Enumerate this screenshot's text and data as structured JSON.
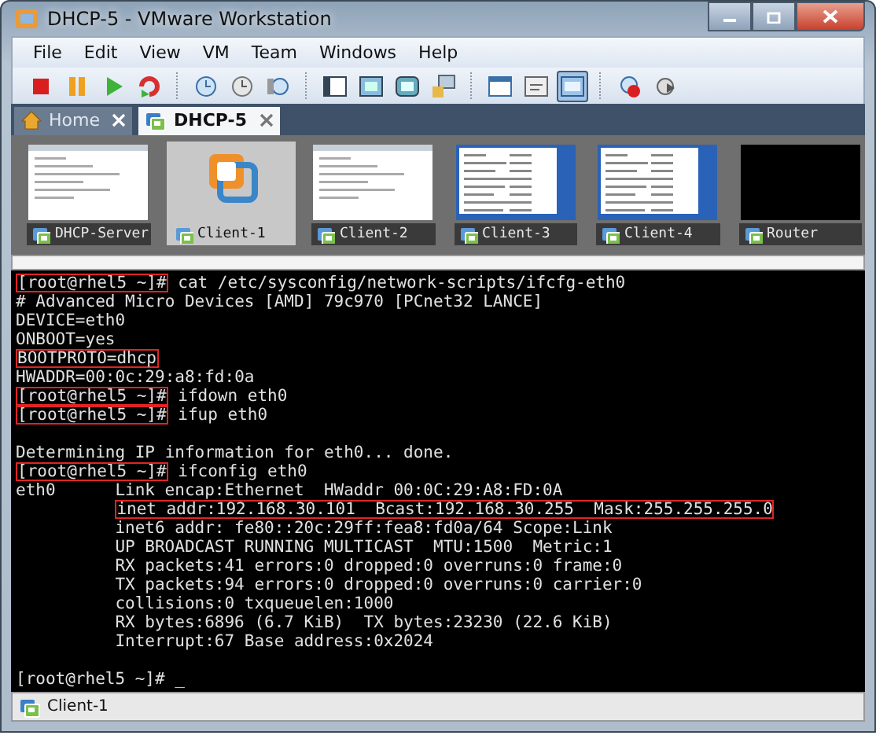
{
  "window": {
    "title": "DHCP-5 - VMware Workstation"
  },
  "menu": [
    "File",
    "Edit",
    "View",
    "VM",
    "Team",
    "Windows",
    "Help"
  ],
  "toolbar": [
    {
      "kind": "stop"
    },
    {
      "kind": "pause"
    },
    {
      "kind": "play"
    },
    {
      "kind": "reset"
    },
    {
      "kind": "sep"
    },
    {
      "kind": "snapshot"
    },
    {
      "kind": "snapshot-revert"
    },
    {
      "kind": "snapshot-manager"
    },
    {
      "kind": "sep"
    },
    {
      "kind": "sidebar"
    },
    {
      "kind": "fullscreen"
    },
    {
      "kind": "quickswitch"
    },
    {
      "kind": "unity"
    },
    {
      "kind": "sep"
    },
    {
      "kind": "console"
    },
    {
      "kind": "summary"
    },
    {
      "kind": "thumbnails",
      "selected": true
    },
    {
      "kind": "sep"
    },
    {
      "kind": "record"
    },
    {
      "kind": "replay"
    }
  ],
  "tabs": [
    {
      "label": "Home",
      "kind": "home",
      "selected": false
    },
    {
      "label": "DHCP-5",
      "kind": "vm",
      "selected": true
    }
  ],
  "thumbnails": [
    {
      "name": "DHCP-Server",
      "kind": "screen",
      "selected": false
    },
    {
      "name": "Client-1",
      "kind": "logo",
      "selected": true
    },
    {
      "name": "Client-2",
      "kind": "screen",
      "selected": false
    },
    {
      "name": "Client-3",
      "kind": "desktop",
      "selected": false
    },
    {
      "name": "Client-4",
      "kind": "desktop",
      "selected": false
    },
    {
      "name": "Router",
      "kind": "blank",
      "selected": false
    }
  ],
  "terminal": {
    "lines": [
      {
        "gap_before": false,
        "segments": [
          {
            "text": "[root@rhel5 ~]#",
            "boxed": true
          },
          {
            "text": " cat /etc/sysconfig/network-scripts/ifcfg-eth0",
            "boxed": false
          }
        ]
      },
      {
        "gap_before": false,
        "segments": [
          {
            "text": "# Advanced Micro Devices [AMD] 79c970 [PCnet32 LANCE]",
            "boxed": false
          }
        ]
      },
      {
        "gap_before": false,
        "segments": [
          {
            "text": "DEVICE=eth0",
            "boxed": false
          }
        ]
      },
      {
        "gap_before": false,
        "segments": [
          {
            "text": "ONBOOT=yes",
            "boxed": false
          }
        ]
      },
      {
        "gap_before": false,
        "segments": [
          {
            "text": "BOOTPROTO=dhcp",
            "boxed": true
          }
        ]
      },
      {
        "gap_before": false,
        "segments": [
          {
            "text": "HWADDR=00:0c:29:a8:fd:0a",
            "boxed": false
          }
        ]
      },
      {
        "gap_before": false,
        "segments": [
          {
            "text": "[root@rhel5 ~]#",
            "boxed": true
          },
          {
            "text": " ifdown eth0",
            "boxed": false
          }
        ]
      },
      {
        "gap_before": false,
        "segments": [
          {
            "text": "[root@rhel5 ~]#",
            "boxed": true
          },
          {
            "text": " ifup eth0",
            "boxed": false
          }
        ]
      },
      {
        "gap_before": true,
        "segments": [
          {
            "text": "Determining IP information for eth0... done.",
            "boxed": false
          }
        ]
      },
      {
        "gap_before": false,
        "segments": [
          {
            "text": "[root@rhel5 ~]#",
            "boxed": true
          },
          {
            "text": " ifconfig eth0",
            "boxed": false
          }
        ]
      },
      {
        "gap_before": false,
        "label": "eth0",
        "segments": [
          {
            "text": "Link encap:Ethernet  HWaddr 00:0C:29:A8:FD:0A",
            "boxed": false
          }
        ]
      },
      {
        "gap_before": false,
        "indented": true,
        "segments": [
          {
            "text": "inet addr:192.168.30.101  Bcast:192.168.30.255  Mask:255.255.255.0",
            "boxed": true
          }
        ]
      },
      {
        "gap_before": false,
        "indented": true,
        "segments": [
          {
            "text": "inet6 addr: fe80::20c:29ff:fea8:fd0a/64 Scope:Link",
            "boxed": false
          }
        ]
      },
      {
        "gap_before": false,
        "indented": true,
        "segments": [
          {
            "text": "UP BROADCAST RUNNING MULTICAST  MTU:1500  Metric:1",
            "boxed": false
          }
        ]
      },
      {
        "gap_before": false,
        "indented": true,
        "segments": [
          {
            "text": "RX packets:41 errors:0 dropped:0 overruns:0 frame:0",
            "boxed": false
          }
        ]
      },
      {
        "gap_before": false,
        "indented": true,
        "segments": [
          {
            "text": "TX packets:94 errors:0 dropped:0 overruns:0 carrier:0",
            "boxed": false
          }
        ]
      },
      {
        "gap_before": false,
        "indented": true,
        "segments": [
          {
            "text": "collisions:0 txqueuelen:1000",
            "boxed": false
          }
        ]
      },
      {
        "gap_before": false,
        "indented": true,
        "segments": [
          {
            "text": "RX bytes:6896 (6.7 KiB)  TX bytes:23230 (22.6 KiB)",
            "boxed": false
          }
        ]
      },
      {
        "gap_before": false,
        "indented": true,
        "segments": [
          {
            "text": "Interrupt:67 Base address:0x2024",
            "boxed": false
          }
        ]
      },
      {
        "gap_before": true,
        "segments": [
          {
            "text": "[root@rhel5 ~]# _",
            "boxed": false
          }
        ]
      }
    ]
  },
  "status_bar": {
    "vm": "Client-1"
  }
}
